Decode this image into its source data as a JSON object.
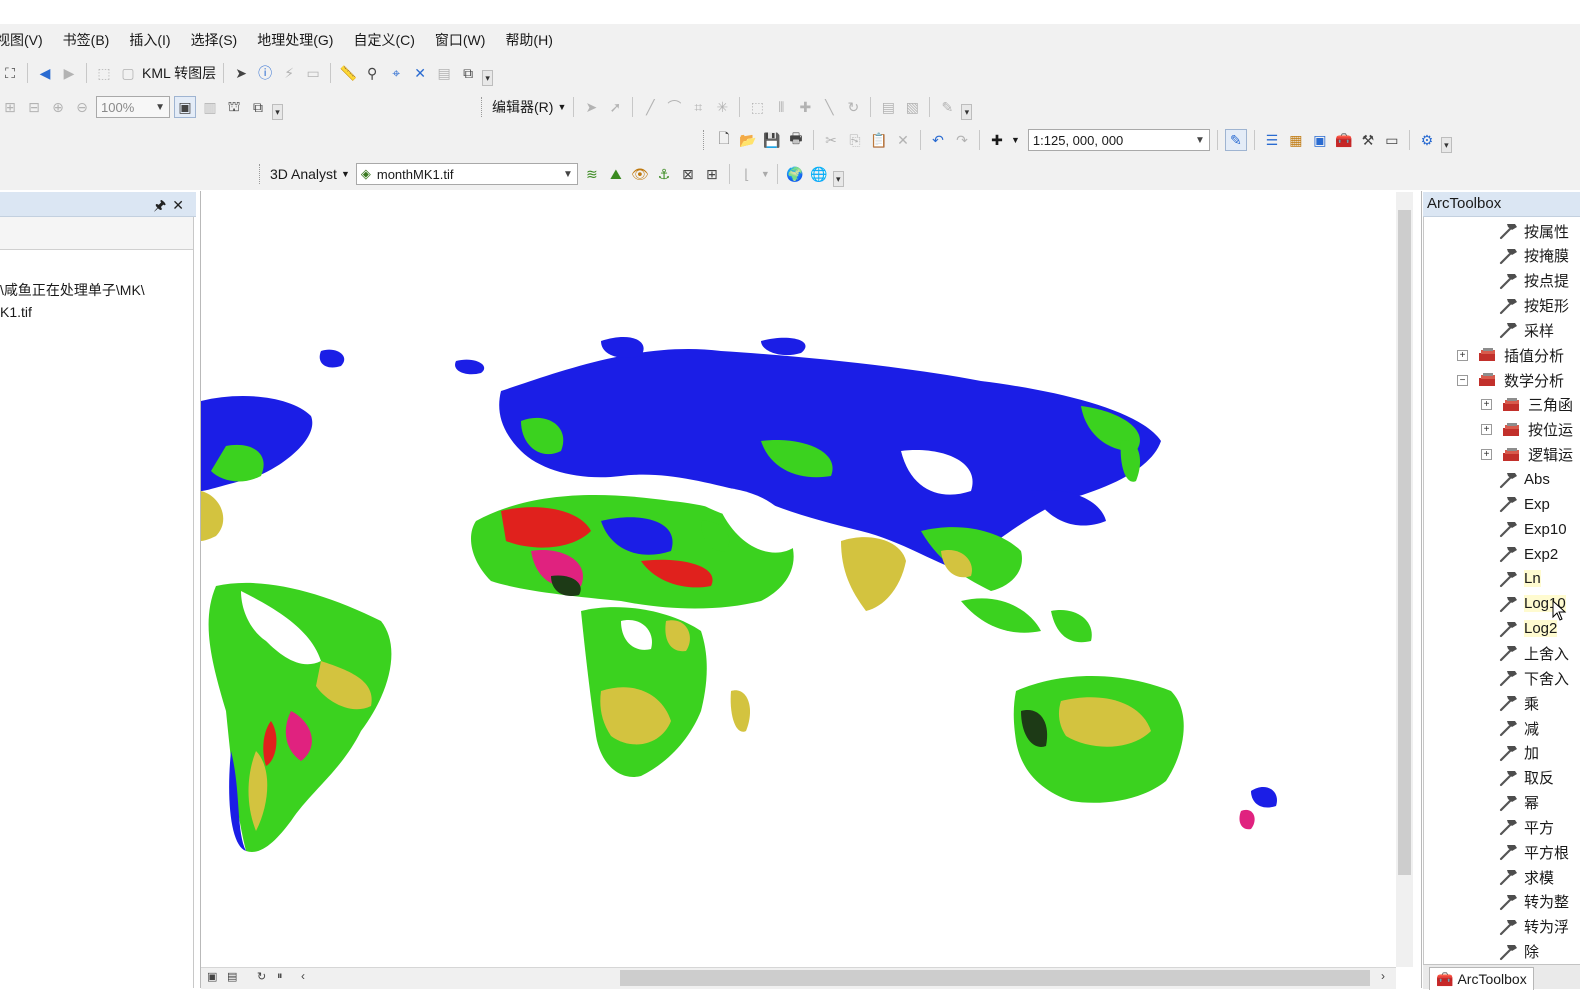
{
  "menubar": [
    "视图(V)",
    "书签(B)",
    "插入(I)",
    "选择(S)",
    "地理处理(G)",
    "自定义(C)",
    "窗口(W)",
    "帮助(H)"
  ],
  "toolbar": {
    "kml_label": "KML 转图层",
    "zoom_value": "100%",
    "editor_label": "编辑器(R)",
    "scale_value": "1:125, 000, 000",
    "analyst_label": "3D Analyst",
    "layer_value": "monthMK1.tif"
  },
  "toc": {
    "path_line1": "\\咸鱼正在处理单子\\MK\\",
    "path_line2": "K1.tif"
  },
  "toolbox": {
    "title": "ArcToolbox",
    "tab_label": "ArcToolbox",
    "items": [
      {
        "label": "按属性",
        "kind": "tool",
        "indent": 1
      },
      {
        "label": "按掩膜",
        "kind": "tool",
        "indent": 1
      },
      {
        "label": "按点提",
        "kind": "tool",
        "indent": 1
      },
      {
        "label": "按矩形",
        "kind": "tool",
        "indent": 1
      },
      {
        "label": "采样",
        "kind": "tool",
        "indent": 1
      },
      {
        "label": "插值分析",
        "kind": "toolset",
        "expander": "+",
        "indent": 0
      },
      {
        "label": "数学分析",
        "kind": "toolset",
        "expander": "-",
        "indent": 0
      },
      {
        "label": "三角函",
        "kind": "toolset",
        "expander": "+",
        "indent": 1
      },
      {
        "label": "按位运",
        "kind": "toolset",
        "expander": "+",
        "indent": 1
      },
      {
        "label": "逻辑运",
        "kind": "toolset",
        "expander": "+",
        "indent": 1
      },
      {
        "label": "Abs",
        "kind": "tool",
        "indent": 1
      },
      {
        "label": "Exp",
        "kind": "tool",
        "indent": 1
      },
      {
        "label": "Exp10",
        "kind": "tool",
        "indent": 1
      },
      {
        "label": "Exp2",
        "kind": "tool",
        "indent": 1
      },
      {
        "label": "Ln",
        "kind": "tool",
        "indent": 1,
        "highlight": true
      },
      {
        "label": "Log10",
        "kind": "tool",
        "indent": 1,
        "highlight": true
      },
      {
        "label": "Log2",
        "kind": "tool",
        "indent": 1,
        "highlight": true
      },
      {
        "label": "上舍入",
        "kind": "tool",
        "indent": 1
      },
      {
        "label": "下舍入",
        "kind": "tool",
        "indent": 1
      },
      {
        "label": "乘",
        "kind": "tool",
        "indent": 1
      },
      {
        "label": "减",
        "kind": "tool",
        "indent": 1
      },
      {
        "label": "加",
        "kind": "tool",
        "indent": 1
      },
      {
        "label": "取反",
        "kind": "tool",
        "indent": 1
      },
      {
        "label": "幂",
        "kind": "tool",
        "indent": 1
      },
      {
        "label": "平方",
        "kind": "tool",
        "indent": 1
      },
      {
        "label": "平方根",
        "kind": "tool",
        "indent": 1
      },
      {
        "label": "求模",
        "kind": "tool",
        "indent": 1
      },
      {
        "label": "转为整",
        "kind": "tool",
        "indent": 1
      },
      {
        "label": "转为浮",
        "kind": "tool",
        "indent": 1
      },
      {
        "label": "除",
        "kind": "tool",
        "indent": 1
      }
    ]
  },
  "map_colors": {
    "class_blue": "#1b1ee6",
    "class_green": "#3bd21f",
    "class_yellow": "#d3c33f",
    "class_red": "#e0211d",
    "class_pink": "#e0227f",
    "class_dark": "#1d3a16"
  }
}
